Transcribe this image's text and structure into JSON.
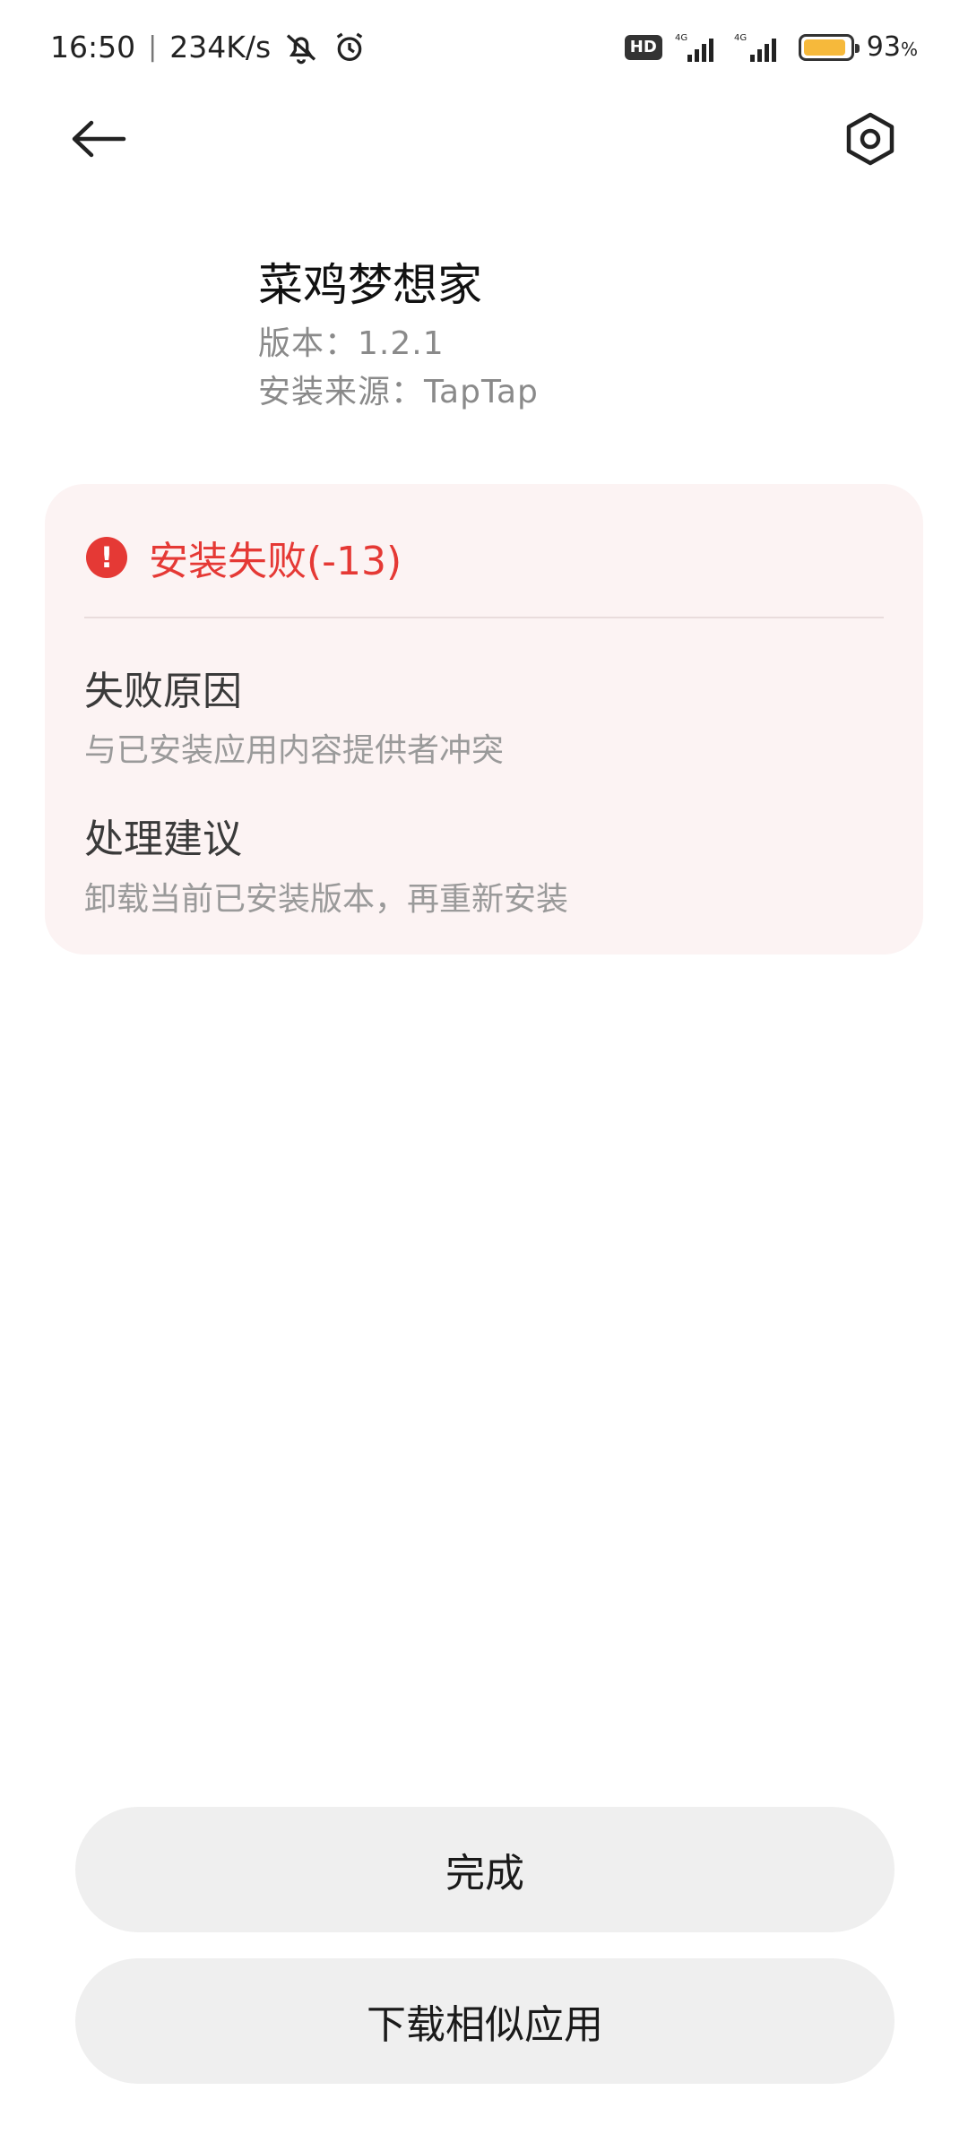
{
  "status_bar": {
    "time": "16:50",
    "separator": "|",
    "network_speed": "234K/s",
    "hd_label": "HD",
    "signal1_label": "4G",
    "signal2_label": "4G",
    "battery_level": 93,
    "battery_text": "93",
    "battery_unit": "%",
    "battery_color": "#f6b93b"
  },
  "header": {
    "back_icon": "arrow-left-icon",
    "settings_icon": "hexagon-settings-icon"
  },
  "app": {
    "name": "菜鸡梦想家",
    "version": "版本：1.2.1",
    "source": "安装来源：TapTap"
  },
  "error": {
    "icon": "exclamation-icon",
    "icon_symbol": "!",
    "title": "安装失败(-13)",
    "accent_color": "#e53935",
    "reason_title": "失败原因",
    "reason_text": "与已安装应用内容提供者冲突",
    "advice_title": "处理建议",
    "advice_text": "卸载当前已安装版本，再重新安装"
  },
  "actions": {
    "done": "完成",
    "download_similar": "下载相似应用"
  }
}
